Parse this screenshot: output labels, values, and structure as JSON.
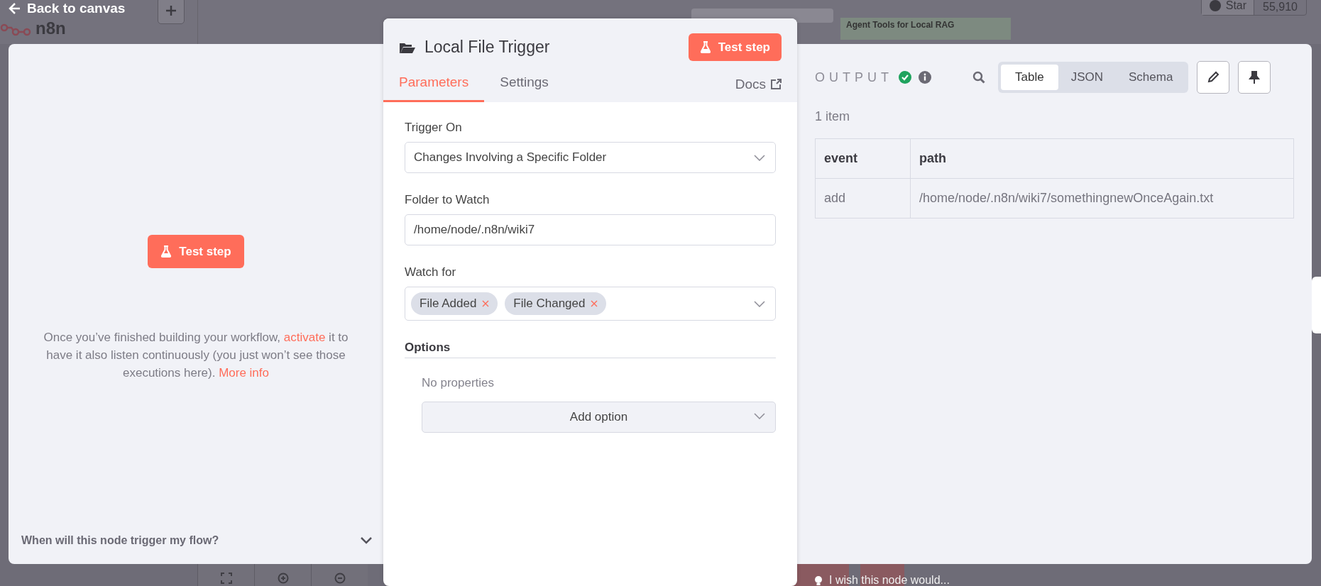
{
  "canvas": {
    "back_link": "Back to canvas",
    "logo": "n8n",
    "workflow_title": "Agent Tools for Local RAG",
    "star": {
      "label": "Star",
      "count": "55,910"
    },
    "feedback": "I wish this node would..."
  },
  "input_panel": {
    "test_button": "Test step",
    "hint": {
      "before": "Once you’ve finished building your workflow, ",
      "link": "activate",
      "after": " it to have it also listen continuously (you just won’t see those executions here).  ",
      "more_link": "More info"
    },
    "faq": {
      "question": "When will this node trigger my flow?",
      "expanded": false
    }
  },
  "node_panel": {
    "title": "Local File Trigger",
    "test_button": "Test step",
    "tabs": [
      {
        "label": "Parameters",
        "selected": true
      },
      {
        "label": "Settings",
        "selected": false
      }
    ],
    "docs": "Docs",
    "fields": [
      {
        "kind": "select",
        "label": "Trigger On",
        "value": "Changes Involving a Specific Folder"
      },
      {
        "kind": "text",
        "label": "Folder to Watch",
        "value": "/home/node/.n8n/wiki7"
      },
      {
        "kind": "multiselect",
        "label": "Watch for",
        "tags": [
          "File Added",
          "File Changed"
        ]
      }
    ],
    "options": {
      "title": "Options",
      "empty": "No properties",
      "add_button": "Add option"
    }
  },
  "output_panel": {
    "title": "OUTPUT",
    "views": [
      {
        "label": "Table",
        "selected": true
      },
      {
        "label": "JSON",
        "selected": false
      },
      {
        "label": "Schema",
        "selected": false
      }
    ],
    "count": "1 item",
    "table": {
      "columns": [
        "event",
        "path"
      ],
      "rows": [
        [
          "add",
          "/home/node/.n8n/wiki7/somethingnewOnceAgain.txt"
        ]
      ]
    }
  }
}
